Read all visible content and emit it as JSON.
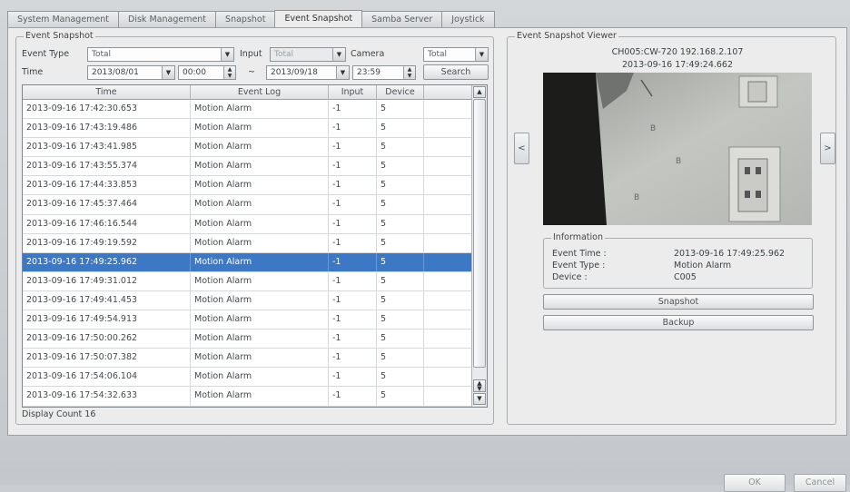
{
  "tabs": [
    {
      "label": "System Management",
      "active": false
    },
    {
      "label": "Disk Management",
      "active": false
    },
    {
      "label": "Snapshot",
      "active": false
    },
    {
      "label": "Event Snapshot",
      "active": true
    },
    {
      "label": "Samba Server",
      "active": false
    },
    {
      "label": "Joystick",
      "active": false
    }
  ],
  "filters": {
    "group_title": "Event Snapshot",
    "event_type_label": "Event Type",
    "event_type_value": "Total",
    "input_label": "Input",
    "input_value": "Total",
    "camera_label": "Camera",
    "camera_value": "Total",
    "time_label": "Time",
    "start_date": "2013/08/01",
    "start_time": "00:00",
    "range_sep": "~",
    "end_date": "2013/09/18",
    "end_time": "23:59",
    "search_label": "Search"
  },
  "table": {
    "columns": [
      "Time",
      "Event Log",
      "Input",
      "Device"
    ],
    "rows": [
      [
        "2013-09-16 17:42:30.653",
        "Motion Alarm",
        "-1",
        "5"
      ],
      [
        "2013-09-16 17:43:19.486",
        "Motion Alarm",
        "-1",
        "5"
      ],
      [
        "2013-09-16 17:43:41.985",
        "Motion Alarm",
        "-1",
        "5"
      ],
      [
        "2013-09-16 17:43:55.374",
        "Motion Alarm",
        "-1",
        "5"
      ],
      [
        "2013-09-16 17:44:33.853",
        "Motion Alarm",
        "-1",
        "5"
      ],
      [
        "2013-09-16 17:45:37.464",
        "Motion Alarm",
        "-1",
        "5"
      ],
      [
        "2013-09-16 17:46:16.544",
        "Motion Alarm",
        "-1",
        "5"
      ],
      [
        "2013-09-16 17:49:19.592",
        "Motion Alarm",
        "-1",
        "5"
      ],
      [
        "2013-09-16 17:49:25.962",
        "Motion Alarm",
        "-1",
        "5"
      ],
      [
        "2013-09-16 17:49:31.012",
        "Motion Alarm",
        "-1",
        "5"
      ],
      [
        "2013-09-16 17:49:41.453",
        "Motion Alarm",
        "-1",
        "5"
      ],
      [
        "2013-09-16 17:49:54.913",
        "Motion Alarm",
        "-1",
        "5"
      ],
      [
        "2013-09-16 17:50:00.262",
        "Motion Alarm",
        "-1",
        "5"
      ],
      [
        "2013-09-16 17:50:07.382",
        "Motion Alarm",
        "-1",
        "5"
      ],
      [
        "2013-09-16 17:54:06.104",
        "Motion Alarm",
        "-1",
        "5"
      ],
      [
        "2013-09-16 17:54:32.633",
        "Motion Alarm",
        "-1",
        "5"
      ]
    ],
    "selected_index": 8,
    "display_count": "Display Count 16"
  },
  "viewer": {
    "group_title": "Event Snapshot Viewer",
    "camera_info": "CH005:CW-720 192.168.2.107",
    "timestamp": "2013-09-16 17:49:24.662",
    "prev_label": "<",
    "next_label": ">",
    "info_title": "Information",
    "event_time_label": "Event Time :",
    "event_time_value": "2013-09-16 17:49:25.962",
    "event_type_label": "Event Type :",
    "event_type_value": "Motion Alarm",
    "device_label": "Device :",
    "device_value": "C005",
    "snapshot_label": "Snapshot",
    "backup_label": "Backup"
  },
  "footer": {
    "ok_label": "OK",
    "cancel_label": "Cancel"
  },
  "colors": {
    "selection": "#3d78c4",
    "panel": "#ececec",
    "background": "#c9cdd1"
  }
}
